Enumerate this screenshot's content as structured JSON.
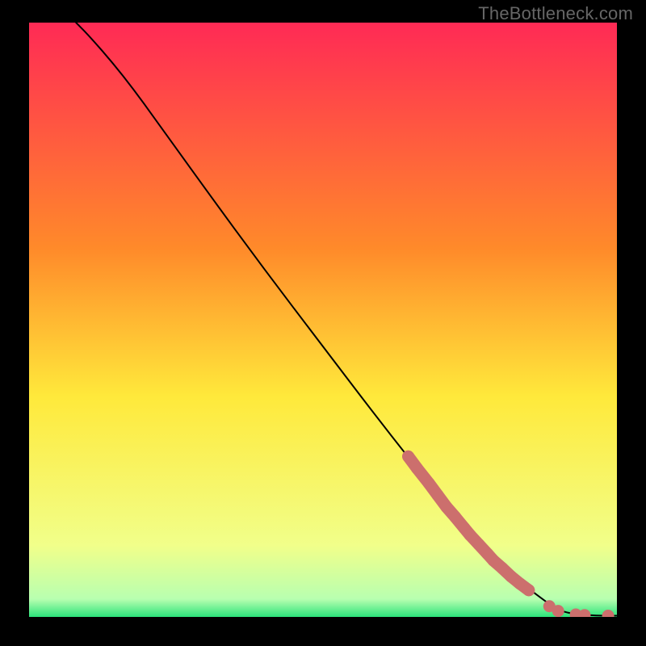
{
  "watermark": "TheBottleneck.com",
  "colors": {
    "gradient_top": "#ff2a55",
    "gradient_upper_mid": "#ff8a2a",
    "gradient_mid": "#ffe93b",
    "gradient_lower": "#f1ff8a",
    "gradient_green_edge": "#2be37a",
    "curve": "#000000",
    "marker_fill": "#cc6f6d",
    "marker_stroke": "#b95d5b"
  },
  "chart_data": {
    "type": "line",
    "title": "",
    "xlabel": "",
    "ylabel": "",
    "xlim": [
      0,
      100
    ],
    "ylim": [
      0,
      100
    ],
    "grid": false,
    "legend": false,
    "curve_note": "Monotone decreasing curve from top-left toward bottom-right; starts near (8,100), convex bend, near-linear mid, flattens near y≈0 after x≈90.",
    "curve_points": [
      {
        "x": 8.0,
        "y": 100.0
      },
      {
        "x": 10.0,
        "y": 98.0
      },
      {
        "x": 14.0,
        "y": 93.5
      },
      {
        "x": 18.0,
        "y": 88.5
      },
      {
        "x": 22.0,
        "y": 83.0
      },
      {
        "x": 30.0,
        "y": 72.0
      },
      {
        "x": 40.0,
        "y": 58.5
      },
      {
        "x": 50.0,
        "y": 45.5
      },
      {
        "x": 60.0,
        "y": 32.5
      },
      {
        "x": 70.0,
        "y": 20.0
      },
      {
        "x": 78.0,
        "y": 11.0
      },
      {
        "x": 84.0,
        "y": 5.5
      },
      {
        "x": 88.0,
        "y": 2.5
      },
      {
        "x": 90.0,
        "y": 1.2
      },
      {
        "x": 92.0,
        "y": 0.6
      },
      {
        "x": 95.0,
        "y": 0.3
      },
      {
        "x": 98.0,
        "y": 0.2
      },
      {
        "x": 100.0,
        "y": 0.2
      }
    ],
    "series": [
      {
        "name": "highlighted-segment",
        "style": "thick-rounded",
        "points": [
          {
            "x": 64.5,
            "y": 27.0
          },
          {
            "x": 66.0,
            "y": 25.0
          },
          {
            "x": 68.0,
            "y": 22.5
          },
          {
            "x": 69.5,
            "y": 20.5
          },
          {
            "x": 71.0,
            "y": 18.5
          },
          {
            "x": 72.5,
            "y": 16.8
          },
          {
            "x": 74.0,
            "y": 15.0
          },
          {
            "x": 75.0,
            "y": 13.8
          },
          {
            "x": 76.5,
            "y": 12.2
          },
          {
            "x": 78.0,
            "y": 10.6
          },
          {
            "x": 79.0,
            "y": 9.5
          },
          {
            "x": 80.5,
            "y": 8.2
          },
          {
            "x": 82.0,
            "y": 6.8
          },
          {
            "x": 83.5,
            "y": 5.6
          },
          {
            "x": 85.0,
            "y": 4.5
          }
        ]
      },
      {
        "name": "tail-markers",
        "style": "dots",
        "points": [
          {
            "x": 88.5,
            "y": 1.8
          },
          {
            "x": 90.0,
            "y": 1.0
          },
          {
            "x": 93.0,
            "y": 0.4
          },
          {
            "x": 94.5,
            "y": 0.3
          },
          {
            "x": 98.5,
            "y": 0.2
          }
        ]
      }
    ]
  }
}
